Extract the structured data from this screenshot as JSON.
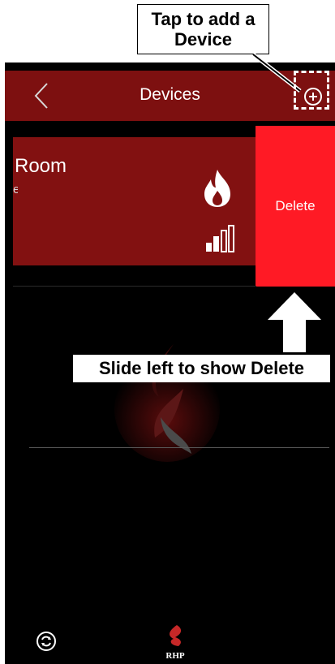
{
  "header": {
    "title": "Devices"
  },
  "device": {
    "name": "Room",
    "subtitle": "e"
  },
  "actions": {
    "delete_label": "Delete"
  },
  "annotations": {
    "add_device_line1": "Tap to add a",
    "add_device_line2": "Device",
    "slide_hint": "Slide left to show Delete"
  },
  "footer": {
    "brand": "RHP"
  },
  "icons": {
    "back": "chevron-left-icon",
    "add": "plus-circle-icon",
    "flame": "flame-icon",
    "signal": "signal-bars-icon",
    "refresh": "refresh-icon",
    "logo": "rhp-logo"
  },
  "colors": {
    "header_bg": "#7d1010",
    "card_bg": "#821111",
    "delete_bg": "#ff1a25",
    "screen_bg": "#000000"
  }
}
